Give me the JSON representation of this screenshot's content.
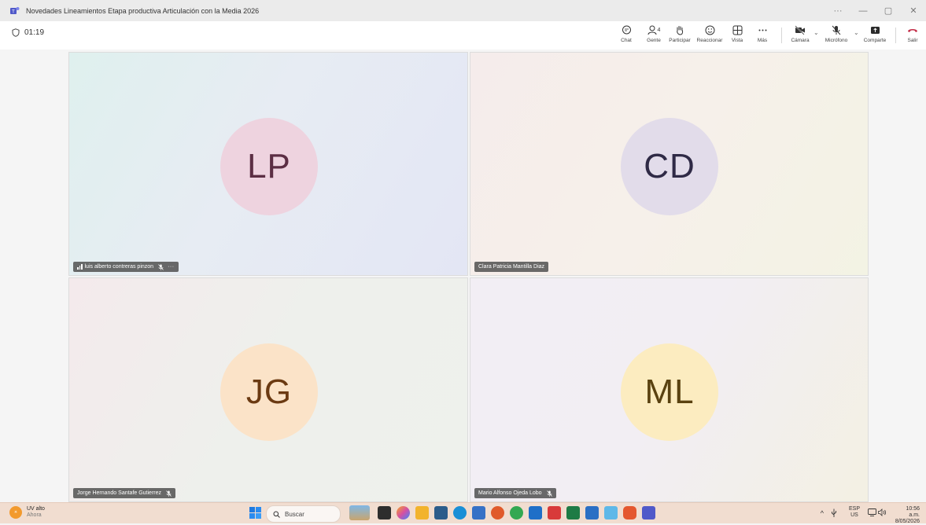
{
  "window": {
    "title": "Novedades Lineamientos Etapa productiva Articulación con la Media 2026",
    "controls": [
      "···",
      "—",
      "▢",
      "✕"
    ]
  },
  "toolbar": {
    "timer": "01:19",
    "chat_label": "Chat",
    "people_label": "Gente",
    "people_count": "4",
    "raise_hand_label": "Participar",
    "react_label": "Reaccionar",
    "view_label": "Vista",
    "more_label": "Más",
    "camera_label": "Cámara",
    "mic_label": "Micrófono",
    "share_label": "Comparte",
    "leave_label": "Salir",
    "leave_color": "#c4314b"
  },
  "participants": [
    {
      "initials": "LP",
      "name": "luis alberto contreras pinzon",
      "avatar_bg": "#eed3df",
      "initials_color": "#5c2e44",
      "muted": true,
      "more": "···"
    },
    {
      "initials": "CD",
      "name": "Clara Patricia Mantilla Diaz",
      "avatar_bg": "#e2dcea",
      "initials_color": "#2f2a46",
      "muted": false
    },
    {
      "initials": "JG",
      "name": "Jorge Hernando Santafe Gutierrez",
      "avatar_bg": "#fbe3c8",
      "initials_color": "#6b3a12",
      "muted": true
    },
    {
      "initials": "ML",
      "name": "Mario Alfonso Ojeda Lobo",
      "avatar_bg": "#fcecc0",
      "initials_color": "#5a4210",
      "muted": true
    }
  ],
  "taskbar": {
    "weather_title": "UV alto",
    "weather_sub": "Ahora",
    "search_placeholder": "Buscar",
    "language": "ESP",
    "region": "US",
    "time": "10:56 a.m.",
    "date": "8/05/2026"
  }
}
